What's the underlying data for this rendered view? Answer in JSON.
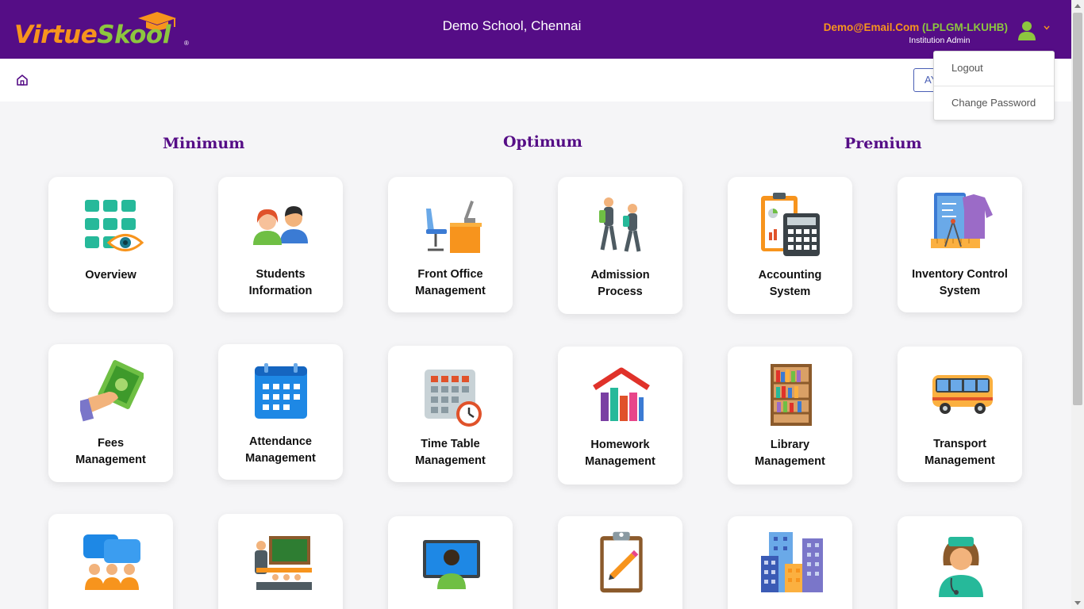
{
  "header": {
    "logo_part1": "Virtue",
    "logo_part2": "Skool",
    "logo_reg": "®",
    "school_name": "Demo School, Chennai",
    "user_email": "Demo@Email.Com",
    "user_code": "(LPLGM-LKUHB)",
    "user_role": "Institution Admin"
  },
  "subbar": {
    "ay_button_label": "AY"
  },
  "dropdown": {
    "items": [
      "Logout",
      "Change Password"
    ]
  },
  "plans": [
    "Minimum",
    "Optimum",
    "Premium"
  ],
  "modules": [
    {
      "label": "Overview",
      "icon": "overview-icon"
    },
    {
      "label": "Students\nInformation",
      "icon": "students-icon"
    },
    {
      "label": "Front Office\nManagement",
      "icon": "front-office-icon"
    },
    {
      "label": "Admission\nProcess",
      "icon": "admission-icon"
    },
    {
      "label": "Accounting\nSystem",
      "icon": "accounting-icon"
    },
    {
      "label": "Inventory Control\nSystem",
      "icon": "inventory-icon"
    },
    {
      "label": "Fees\nManagement",
      "icon": "fees-icon"
    },
    {
      "label": "Attendance\nManagement",
      "icon": "attendance-icon"
    },
    {
      "label": "Time Table\nManagement",
      "icon": "timetable-icon"
    },
    {
      "label": "Homework\nManagement",
      "icon": "homework-icon"
    },
    {
      "label": "Library\nManagement",
      "icon": "library-icon"
    },
    {
      "label": "Transport\nManagement",
      "icon": "transport-icon"
    },
    {
      "label": "",
      "icon": "communication-icon"
    },
    {
      "label": "",
      "icon": "academics-icon"
    },
    {
      "label": "",
      "icon": "online-class-icon"
    },
    {
      "label": "",
      "icon": "exam-icon"
    },
    {
      "label": "",
      "icon": "buildings-icon"
    },
    {
      "label": "",
      "icon": "nurse-icon"
    }
  ],
  "colors": {
    "header_bg": "#550d86",
    "accent_orange": "#f7941d",
    "accent_green": "#8dc63f",
    "plan_title": "#550d86",
    "page_bg": "#f5f5f7"
  }
}
